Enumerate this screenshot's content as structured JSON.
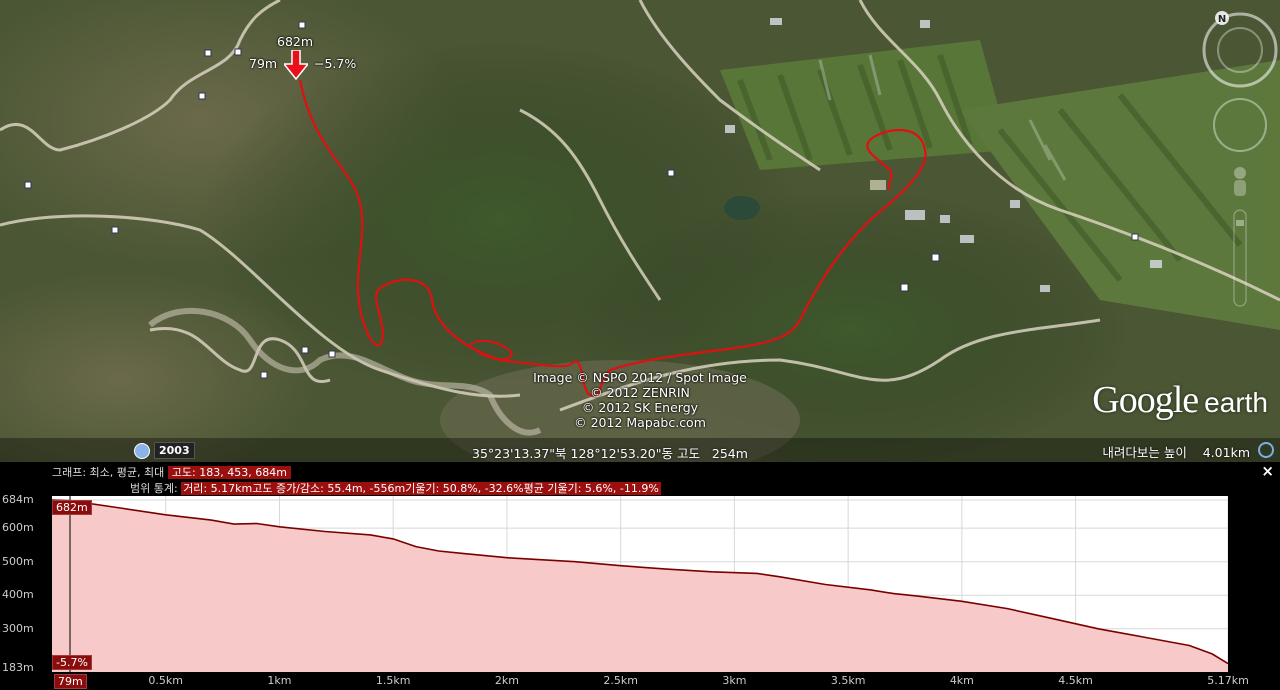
{
  "map": {
    "marker": {
      "elevation": "682m",
      "left_label": "79m",
      "grade": "−5.7%"
    },
    "credits": [
      "Image © NSPO 2012 / Spot Image",
      "© 2012 ZENRIN",
      "© 2012 SK Energy",
      "© 2012 Mapabc.com"
    ],
    "imagery_year": "2003",
    "coords_text": "35°23'13.37\"북 128°12'53.20\"동 고도   254m",
    "eye_alt_label": "내려다보는 높이",
    "eye_alt_value": "4.01km",
    "logo_google": "Google",
    "logo_earth": "earth",
    "compass_label": "N"
  },
  "profile": {
    "line1_prefix": "그래프: 최소, 평균, 최대",
    "line1_highlight": "고도: 183, 453, 684m",
    "line2_prefix": "범위 통계:",
    "line2_highlight": "거리: 5.17km고도 증가/감소: 55.4m, -556m기울기: 50.8%, -32.6%평균 기울기: 5.6%, -11.9%",
    "close": "×",
    "cursor_elev": "682m",
    "cursor_grade": "-5.7%",
    "cursor_dist": "79m"
  },
  "chart_data": {
    "type": "area",
    "x_unit": "km",
    "y_unit": "m",
    "xlim": [
      0,
      5.17
    ],
    "ylim": [
      183,
      684
    ],
    "x_ticks": [
      "0.5km",
      "1km",
      "1.5km",
      "2km",
      "2.5km",
      "3km",
      "3.5km",
      "4km",
      "4.5km",
      "5.17km"
    ],
    "y_ticks": [
      "684m",
      "600m",
      "500m",
      "400m",
      "300m",
      "183m"
    ],
    "x": [
      0,
      0.08,
      0.3,
      0.5,
      0.7,
      0.8,
      0.9,
      1.0,
      1.2,
      1.4,
      1.5,
      1.6,
      1.7,
      1.8,
      2.0,
      2.3,
      2.5,
      2.7,
      2.9,
      3.1,
      3.2,
      3.4,
      3.6,
      3.7,
      3.8,
      4.0,
      4.2,
      4.4,
      4.6,
      4.8,
      5.0,
      5.1,
      5.17
    ],
    "series": [
      {
        "values": [
          684,
          682,
          660,
          640,
          624,
          612,
          614,
          604,
          590,
          580,
          568,
          545,
          532,
          525,
          512,
          500,
          488,
          478,
          470,
          465,
          455,
          432,
          416,
          405,
          398,
          382,
          360,
          330,
          300,
          275,
          250,
          225,
          196
        ]
      }
    ],
    "fill_color": "#f8c9c9",
    "line_color": "#7a0000",
    "grid": true
  }
}
